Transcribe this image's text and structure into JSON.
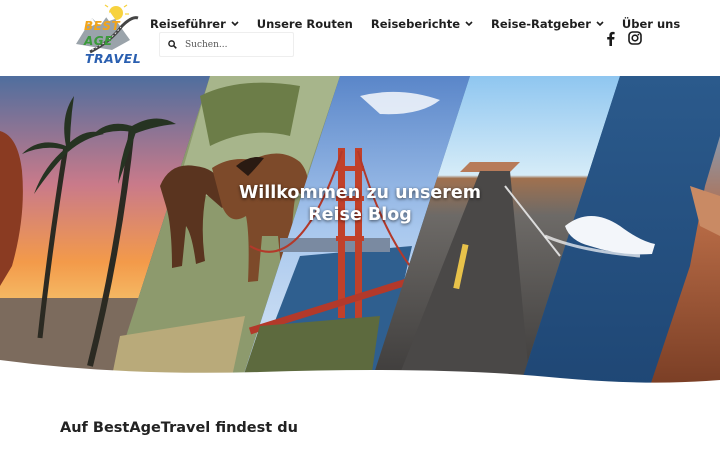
{
  "logo": {
    "line1": "BEST",
    "line2": "AGE",
    "line3": "TRAVEL"
  },
  "nav": {
    "items": [
      {
        "label": "Reiseführer",
        "has_dropdown": true
      },
      {
        "label": "Unsere Routen",
        "has_dropdown": false
      },
      {
        "label": "Reiseberichte",
        "has_dropdown": true
      },
      {
        "label": "Reise-Ratgeber",
        "has_dropdown": true
      },
      {
        "label": "Über uns",
        "has_dropdown": false
      }
    ]
  },
  "search": {
    "placeholder": "Suchen...",
    "value": "",
    "icon": "search-icon"
  },
  "social": {
    "icons": [
      "facebook-icon",
      "instagram-icon"
    ]
  },
  "hero": {
    "title_line1": "Willkommen zu unserem",
    "title_line2": "Reise Blog"
  },
  "content": {
    "heading": "Auf BestAgeTravel findest du"
  },
  "colors": {
    "text": "#1f1f1f",
    "logo_orange": "#f2a51a",
    "logo_green": "#3a9a3a",
    "logo_blue": "#2a5fb0",
    "hero_title": "#ffffff",
    "background": "#ffffff"
  }
}
